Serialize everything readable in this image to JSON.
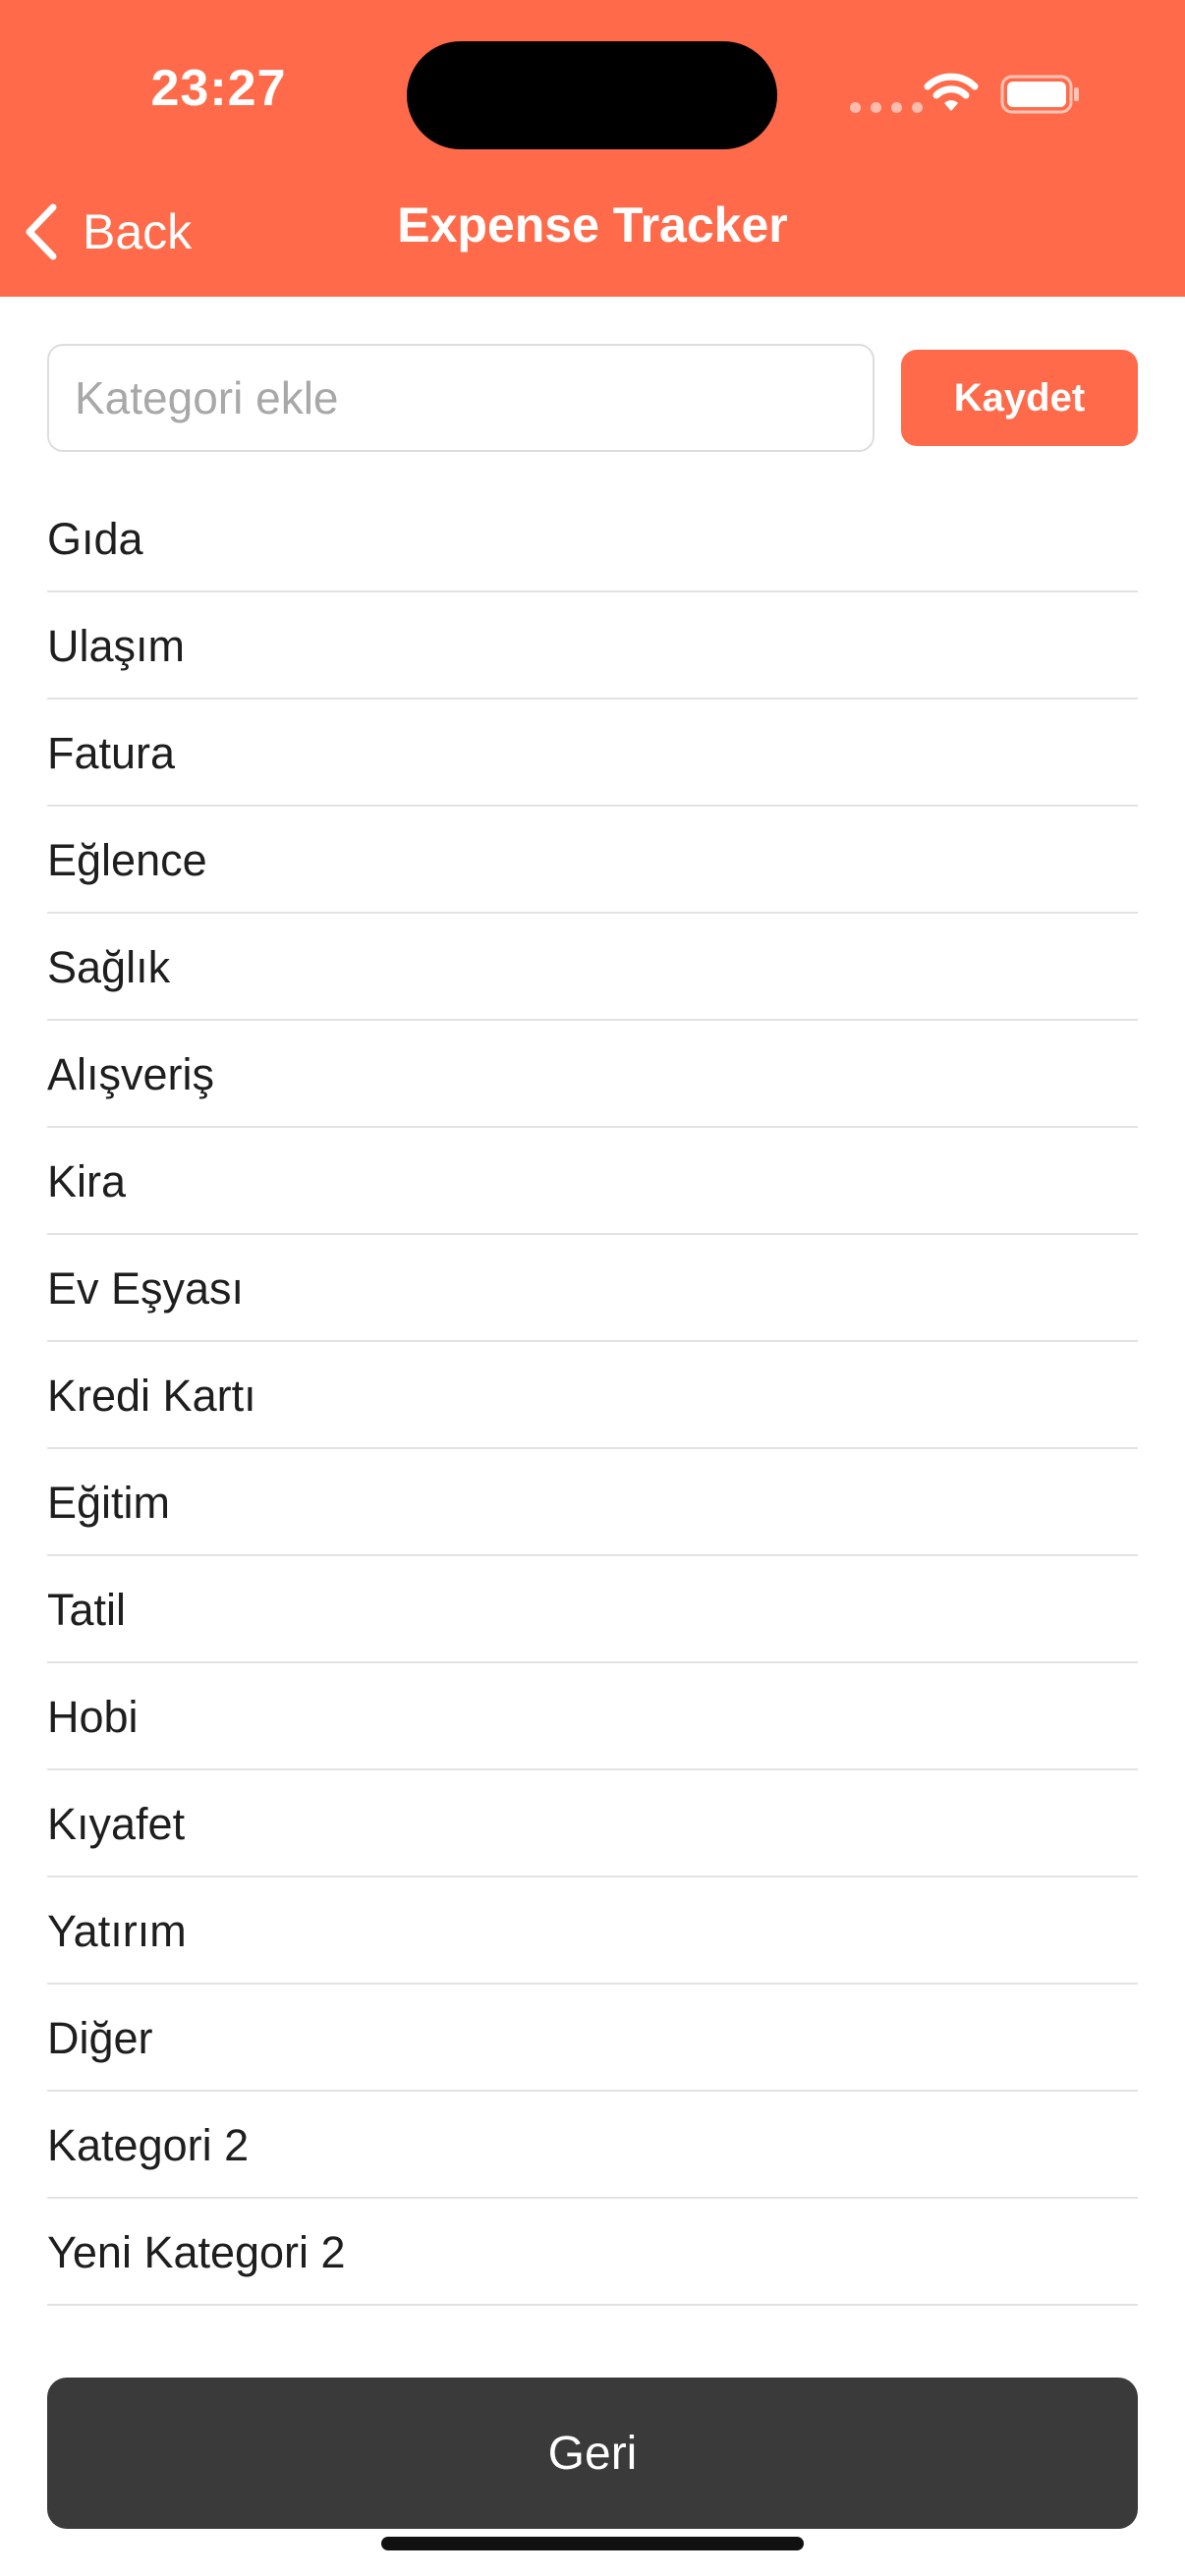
{
  "status_bar": {
    "time": "23:27"
  },
  "nav": {
    "back_label": "Back",
    "title": "Expense Tracker"
  },
  "add_category": {
    "placeholder": "Kategori ekle",
    "value": "",
    "save_label": "Kaydet"
  },
  "categories": [
    "Gıda",
    "Ulaşım",
    "Fatura",
    "Eğlence",
    "Sağlık",
    "Alışveriş",
    "Kira",
    "Ev Eşyası",
    "Kredi Kartı",
    "Eğitim",
    "Tatil",
    "Hobi",
    "Kıyafet",
    "Yatırım",
    "Diğer",
    "Kategori 2",
    "Yeni Kategori 2"
  ],
  "footer": {
    "back_button_label": "Geri"
  },
  "colors": {
    "accent": "#FF6B4A",
    "dark_button": "#3A3A3A",
    "divider": "#E2E2E2"
  },
  "icons": {
    "back": "chevron-left-icon",
    "wifi": "wifi-icon",
    "battery": "battery-icon",
    "signal": "cellular-signal-icon"
  }
}
